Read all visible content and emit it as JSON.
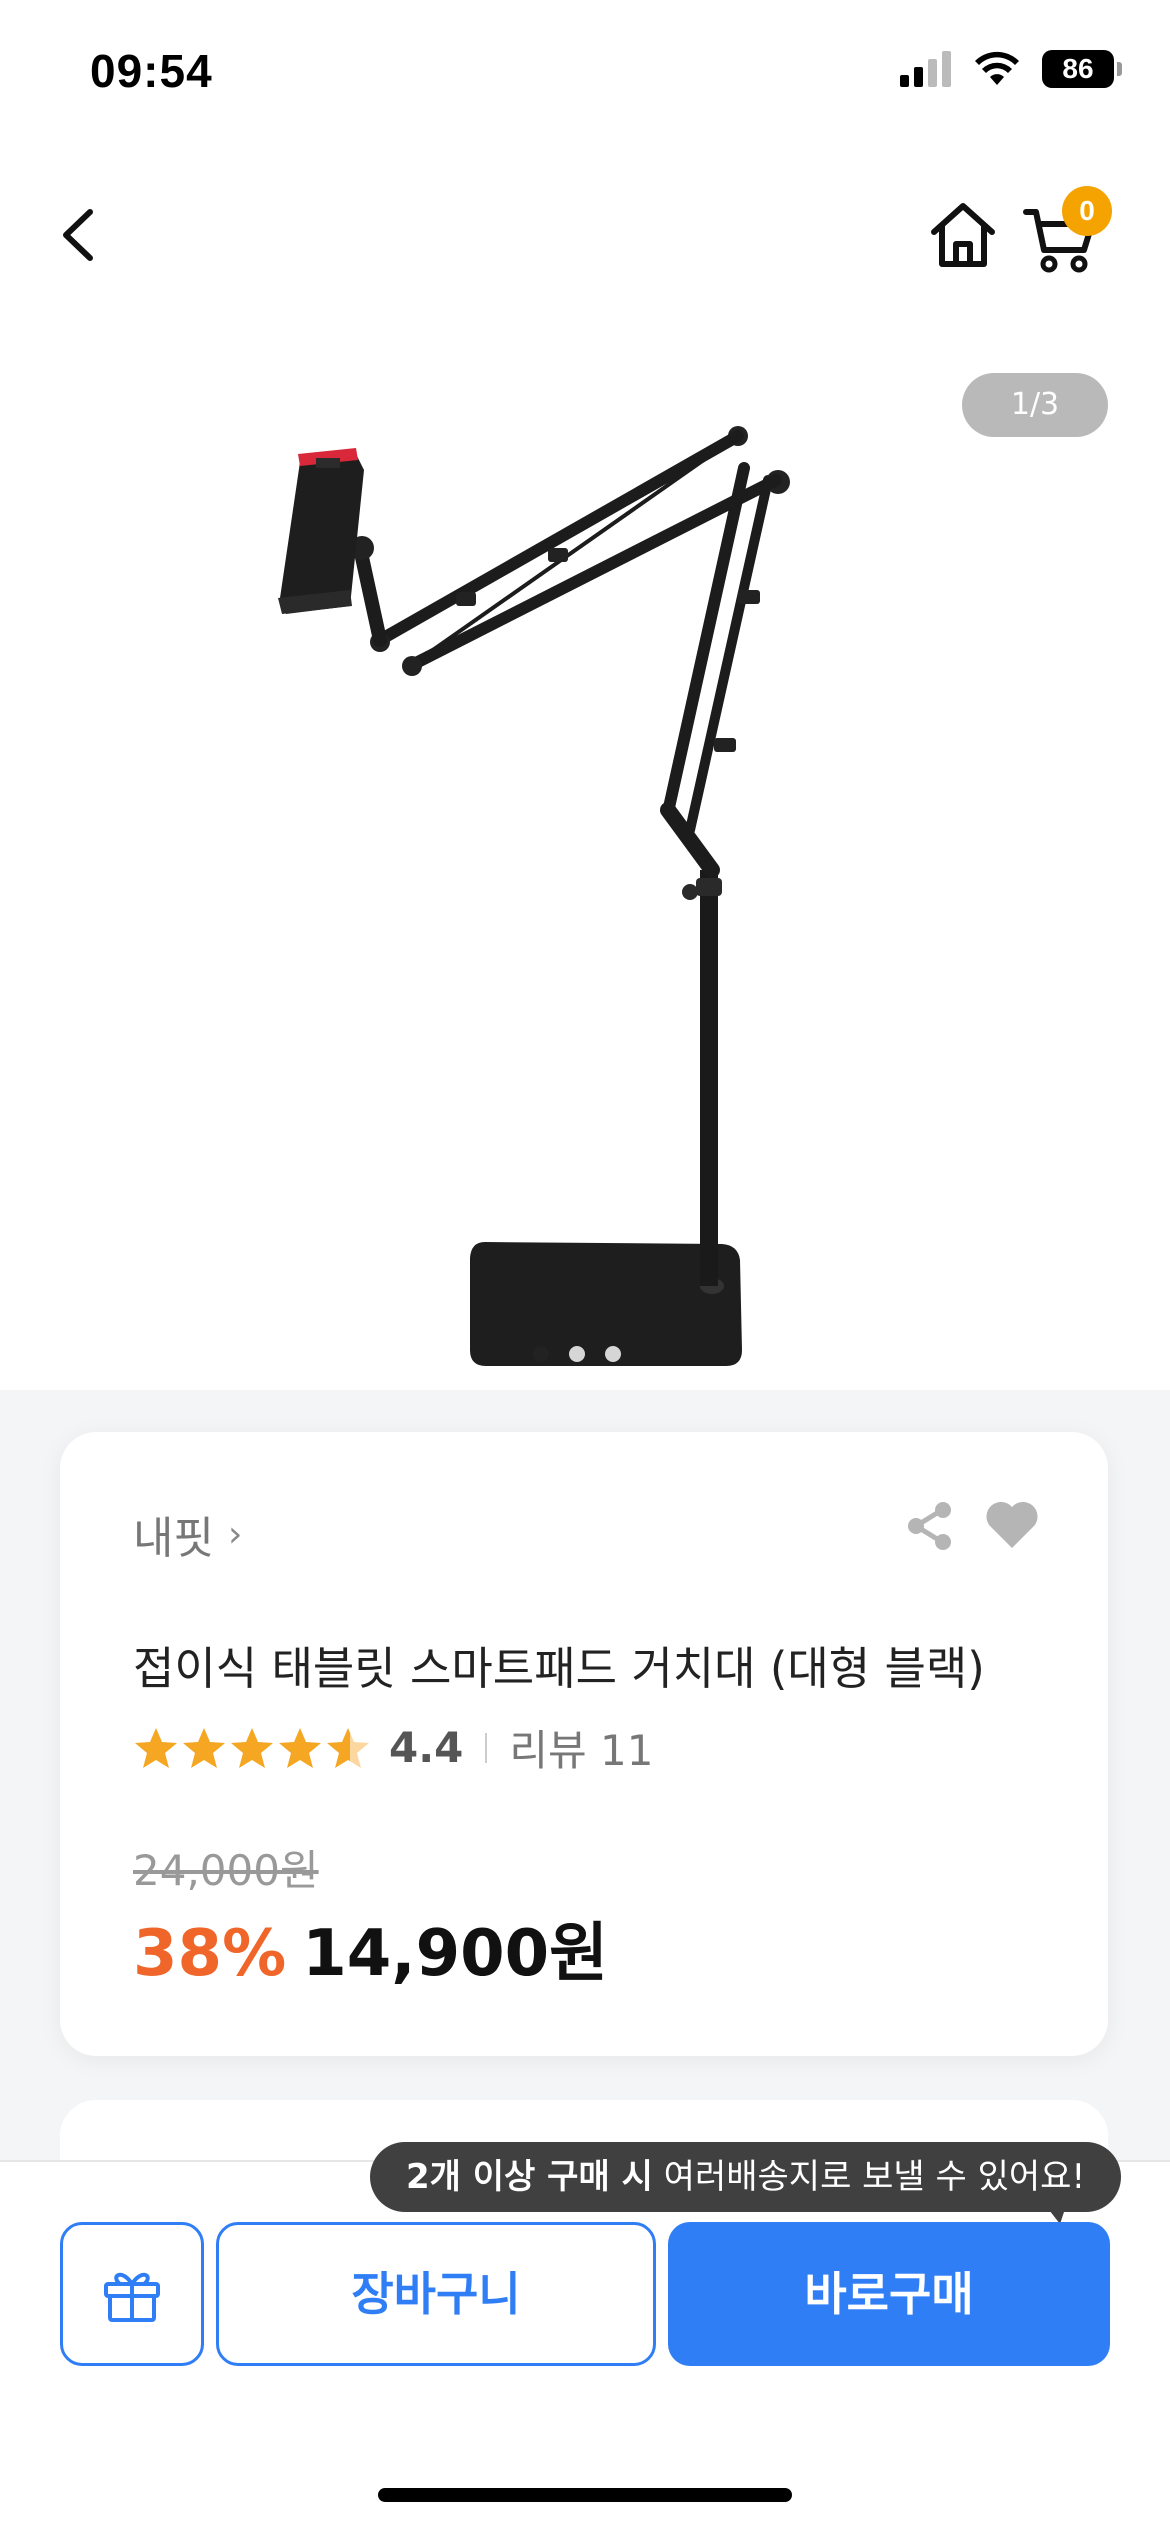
{
  "status_bar": {
    "time": "09:54",
    "battery": "86"
  },
  "nav": {
    "back_icon": "chevron-left-icon",
    "home_icon": "home-icon",
    "cart_icon": "cart-icon",
    "cart_count": "0"
  },
  "gallery": {
    "counter": "1/3",
    "dots_total": 3,
    "active_dot": 0
  },
  "product": {
    "brand": "내핏",
    "brand_chevron": "›",
    "title": "접이식 태블릿 스마트패드 거치대 (대형 블랙)",
    "rating": 4.4,
    "rating_label": "4.4",
    "review_label": "리뷰 11",
    "original_price": "24,000원",
    "discount": "38%",
    "price": "14,900원"
  },
  "bottom_bar": {
    "tooltip_bold": "2개 이상 구매 시",
    "tooltip_rest": " 여러배송지로 보낼 수 있어요!",
    "gift_icon": "gift-icon",
    "cart_button": "장바구니",
    "buy_button": "바로구매"
  },
  "colors": {
    "accent": "#2f7ef5",
    "discount": "#f0662a",
    "star": "#f5a623",
    "badge": "#f5a300"
  }
}
